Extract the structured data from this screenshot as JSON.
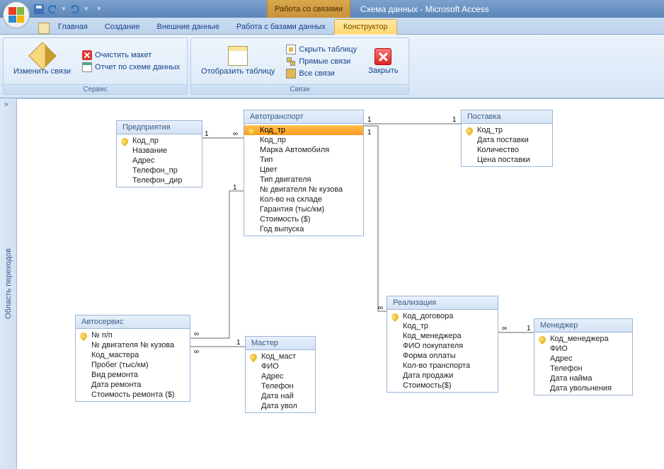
{
  "titlebar": {
    "context_tab": "Работа со связями",
    "title": "Схема данных - Microsoft Access"
  },
  "tabs": {
    "home": "Главная",
    "create": "Создание",
    "external": "Внешние данные",
    "dbtools": "Работа с базами данных",
    "designer": "Конструктор"
  },
  "ribbon": {
    "group_service": "Сервис",
    "group_links": "Связи",
    "edit_links": "Изменить связи",
    "clear_layout": "Очистить макет",
    "report": "Отчет по схеме данных",
    "show_table": "Отобразить таблицу",
    "hide_table": "Скрыть таблицу",
    "direct_links": "Прямые связи",
    "all_links": "Все связи",
    "close": "Закрыть"
  },
  "sidebar": {
    "label": "Область переходов"
  },
  "tables": {
    "predpr": {
      "title": "Предприятия",
      "fields": [
        "Код_пр",
        "Название",
        "Адрес",
        "Телефон_пр",
        "Телефон_дир"
      ],
      "pk": [
        0
      ]
    },
    "avto": {
      "title": "Автотранспорт",
      "fields": [
        "Код_тр",
        "Код_пр",
        "Марка Автомобиля",
        "Тип",
        "Цвет",
        "Тип двигателя",
        "№ двигателя № кузова",
        "Кол-во на складе",
        "Гарантия  (тыс/км)",
        "Стоимость ($)",
        "Год выпуска"
      ],
      "pk": [
        0
      ],
      "selected": 0
    },
    "postavka": {
      "title": "Поставка",
      "fields": [
        "Код_тр",
        "Дата поставки",
        "Количество",
        "Цена поставки"
      ],
      "pk": [
        0
      ]
    },
    "autoservice": {
      "title": "Автосервис",
      "fields": [
        "№ п/п",
        "№ двигателя № кузова",
        "Код_мастера",
        "Пробег (тыс/км)",
        "Вид ремонта",
        "Дата ремонта",
        "Стоимость ремонта ($)"
      ],
      "pk": [
        0
      ]
    },
    "master": {
      "title": "Мастер",
      "fields": [
        "Код_маст",
        "ФИО",
        "Адрес",
        "Телефон",
        "Дата най",
        "Дата увол"
      ],
      "pk": [
        0
      ]
    },
    "realiz": {
      "title": "Реализация",
      "fields": [
        "Код_договора",
        "Код_тр",
        "Код_менеджера",
        "ФИО покупателя",
        "Форма оплаты",
        "Кол-во транспорта",
        "Дата продажи",
        "Стоимость($)"
      ],
      "pk": [
        0
      ]
    },
    "manager": {
      "title": "Менеджер",
      "fields": [
        "Код_менеджера",
        "ФИО",
        "Адрес",
        "Телефон",
        "Дата найма",
        "Дата увольнения"
      ],
      "pk": [
        0
      ]
    }
  },
  "rel_labels": {
    "one": "1",
    "many": "∞"
  }
}
